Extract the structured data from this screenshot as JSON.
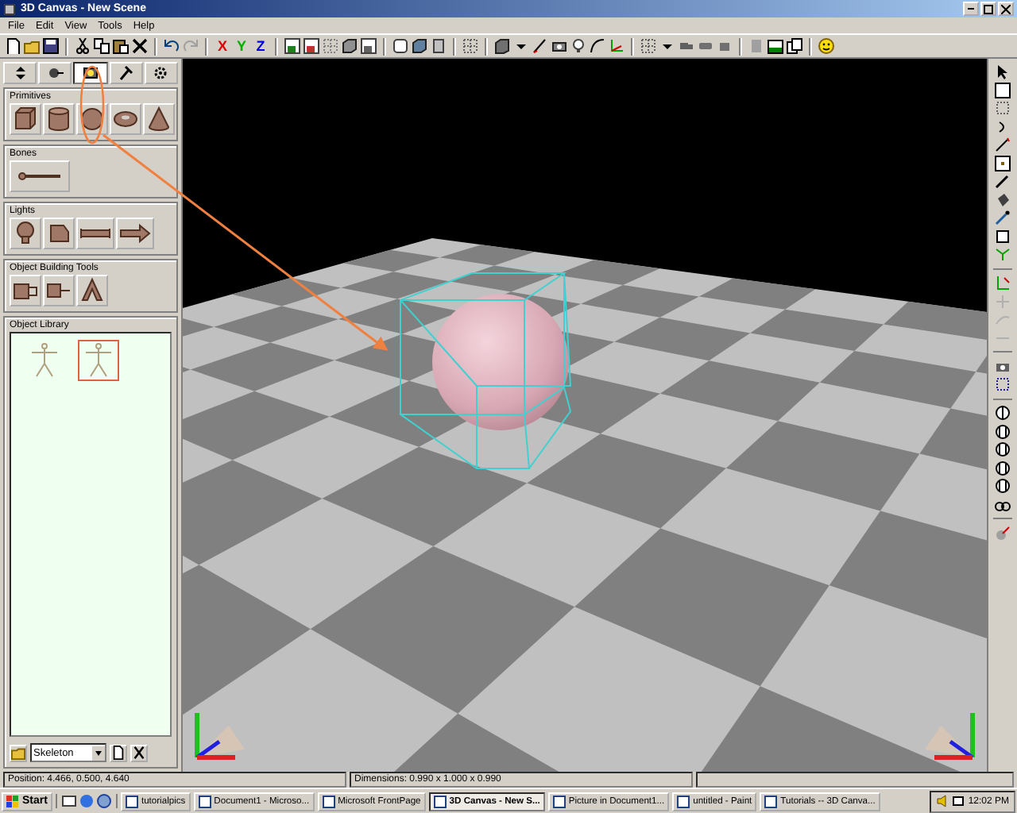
{
  "window": {
    "title": "3D Canvas - New Scene"
  },
  "menu": [
    "File",
    "Edit",
    "View",
    "Tools",
    "Help"
  ],
  "axis_toggles": [
    {
      "label": "X",
      "color": "#e00000"
    },
    {
      "label": "Y",
      "color": "#00b000"
    },
    {
      "label": "Z",
      "color": "#0000e0"
    }
  ],
  "panel_tabs": [
    {
      "selected": false
    },
    {
      "selected": false
    },
    {
      "selected": true
    },
    {
      "selected": false
    },
    {
      "selected": false
    }
  ],
  "sections": [
    {
      "title": "Primitives",
      "kind": "primitives"
    },
    {
      "title": "Bones",
      "kind": "bones"
    },
    {
      "title": "Lights",
      "kind": "lights"
    },
    {
      "title": "Object Building Tools",
      "kind": "building"
    }
  ],
  "library": {
    "title": "Object Library",
    "items": [
      {
        "selected": false
      },
      {
        "selected": true
      }
    ],
    "dropdown": "Skeleton"
  },
  "status_bar": [
    "Position: 4.466, 0.500, 4.640",
    "Dimensions: 0.990 x 1.000 x 0.990"
  ],
  "taskbar": {
    "start": "Start",
    "tasks": [
      {
        "label": "tutorialpics",
        "selected": false
      },
      {
        "label": "Document1 - Microso...",
        "selected": false
      },
      {
        "label": "Microsoft FrontPage",
        "selected": false
      },
      {
        "label": "3D Canvas - New S...",
        "selected": true
      },
      {
        "label": "Picture in Document1...",
        "selected": false
      },
      {
        "label": "untitled - Paint",
        "selected": false
      },
      {
        "label": "Tutorials -- 3D Canva...",
        "selected": false
      }
    ],
    "clock": "12:02 PM"
  }
}
